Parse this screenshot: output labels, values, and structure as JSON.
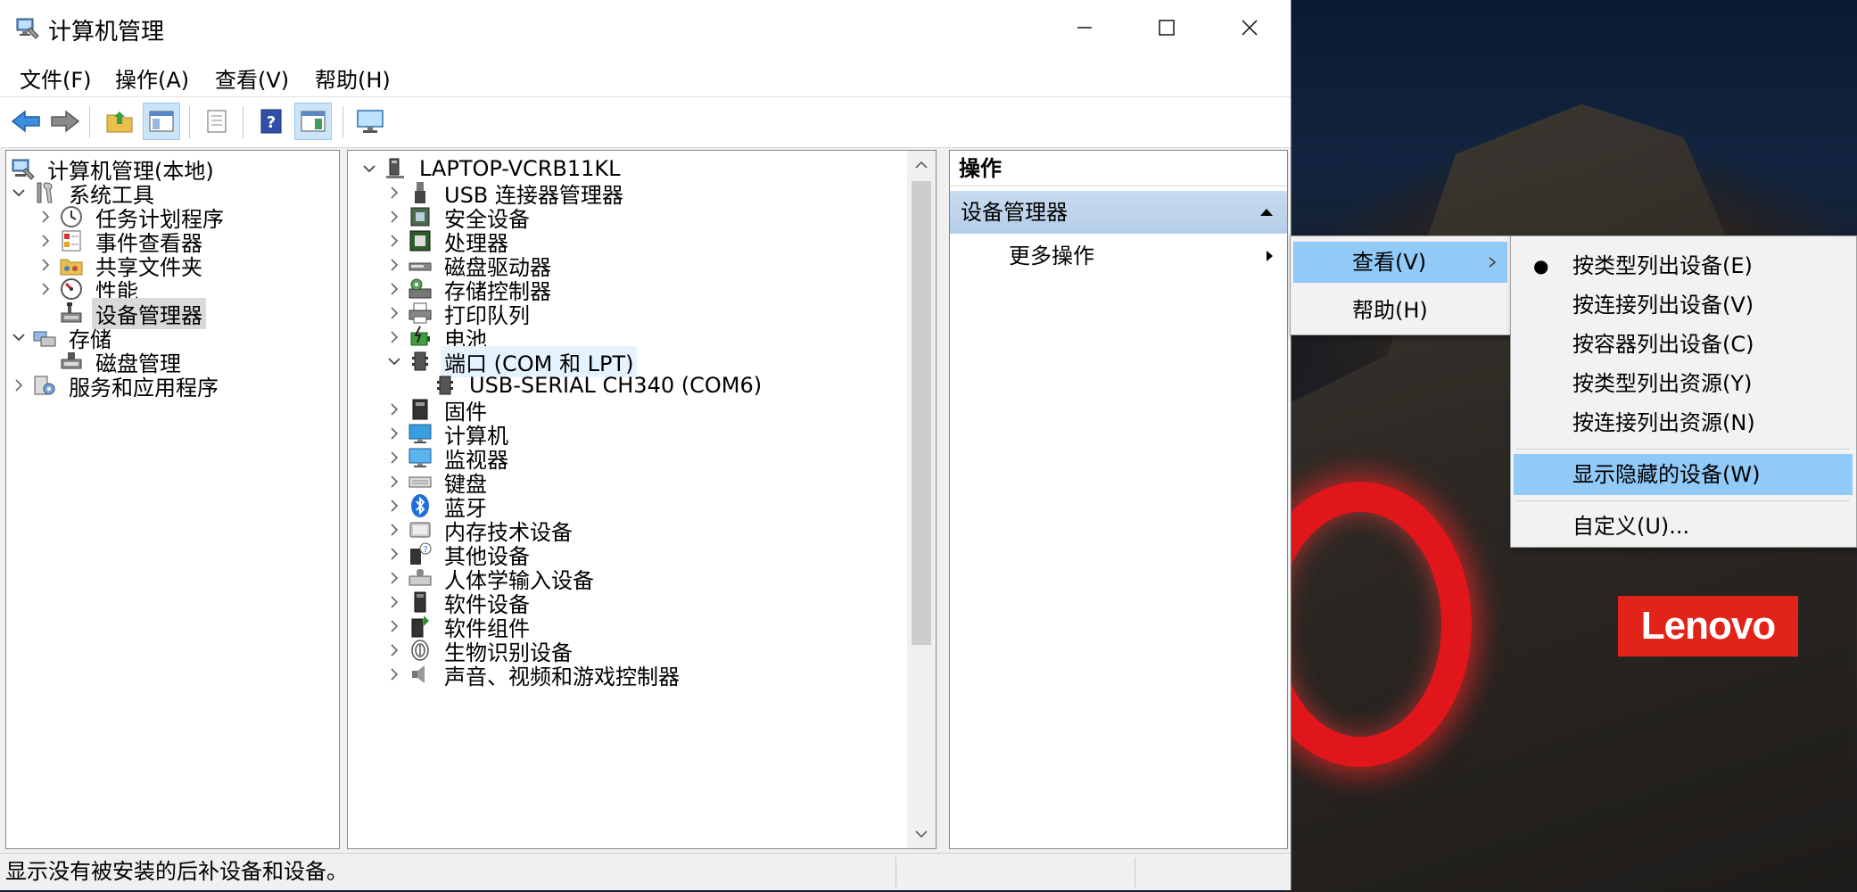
{
  "window": {
    "title": "计算机管理",
    "minimize_glyph": "—",
    "maximize_glyph": "☐",
    "close_glyph": "✕"
  },
  "menubar": [
    "文件(F)",
    "操作(A)",
    "查看(V)",
    "帮助(H)"
  ],
  "toolbar": [
    "back-icon",
    "forward-icon",
    "up-folder-icon",
    "show-hide-console-tree-icon",
    "properties-icon",
    "help-icon",
    "show-hide-action-pane-icon",
    "monitor-icon"
  ],
  "left_tree": [
    {
      "label": "计算机管理(本地)",
      "icon": "computer-management-icon"
    },
    {
      "label": "系统工具",
      "icon": "tools-icon"
    },
    {
      "label": "任务计划程序",
      "icon": "clock-icon"
    },
    {
      "label": "事件查看器",
      "icon": "event-viewer-icon"
    },
    {
      "label": "共享文件夹",
      "icon": "shared-folder-icon"
    },
    {
      "label": "性能",
      "icon": "performance-icon"
    },
    {
      "label": "设备管理器",
      "icon": "device-manager-icon"
    },
    {
      "label": "存储",
      "icon": "storage-icon"
    },
    {
      "label": "磁盘管理",
      "icon": "disk-management-icon"
    },
    {
      "label": "服务和应用程序",
      "icon": "services-icon"
    }
  ],
  "device_tree": {
    "root": "LAPTOP-VCRB11KL",
    "categories": [
      "USB 连接器管理器",
      "安全设备",
      "处理器",
      "磁盘驱动器",
      "存储控制器",
      "打印队列",
      "电池",
      "端口 (COM 和 LPT)",
      "USB-SERIAL CH340 (COM6)",
      "固件",
      "计算机",
      "监视器",
      "键盘",
      "蓝牙",
      "内存技术设备",
      "其他设备",
      "人体学输入设备",
      "软件设备",
      "软件组件",
      "生物识别设备",
      "声音、视频和游戏控制器"
    ]
  },
  "actions": {
    "header": "操作",
    "section": "设备管理器",
    "more": "更多操作"
  },
  "context_menu": {
    "items": [
      "查看(V)",
      "帮助(H)"
    ],
    "submenu": [
      "按类型列出设备(E)",
      "按连接列出设备(V)",
      "按容器列出设备(C)",
      "按类型列出资源(Y)",
      "按连接列出资源(N)",
      "显示隐藏的设备(W)",
      "自定义(U)..."
    ]
  },
  "status_text": "显示没有被安装的后补设备和设备。",
  "wallpaper": {
    "brand": "Lenovo"
  },
  "colors": {
    "accent": "#91c9f7",
    "brand": "#e2231a"
  }
}
